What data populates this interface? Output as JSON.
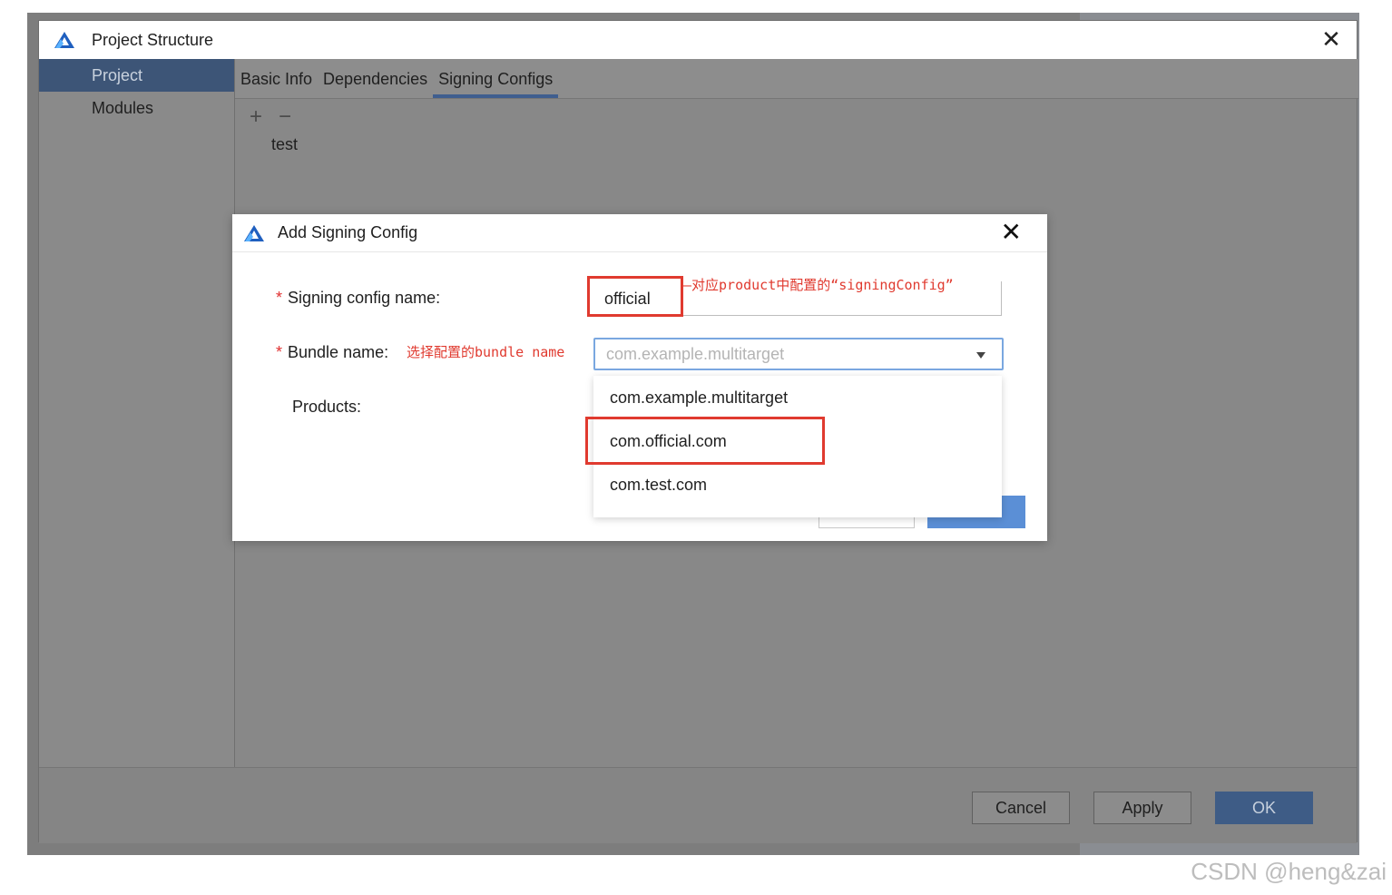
{
  "window": {
    "title": "Project Structure",
    "close_glyph": "✕"
  },
  "sidebar": {
    "items": [
      {
        "label": "Project",
        "active": true
      },
      {
        "label": "Modules",
        "active": false
      }
    ]
  },
  "tabs": [
    {
      "label": "Basic Info",
      "active": false
    },
    {
      "label": "Dependencies",
      "active": false
    },
    {
      "label": "Signing Configs",
      "active": true
    }
  ],
  "toolbar": {
    "add_glyph": "+",
    "remove_glyph": "−"
  },
  "configs": {
    "items": [
      "test"
    ]
  },
  "footer": {
    "cancel_label": "Cancel",
    "apply_label": "Apply",
    "ok_label": "OK"
  },
  "dialog": {
    "title": "Add Signing Config",
    "close_glyph": "✕",
    "signing_config_name": {
      "label": "Signing config name:",
      "required_mark": "*",
      "value": "official"
    },
    "bundle_name": {
      "label": "Bundle name:",
      "required_mark": "*",
      "selected": "com.example.multitarget",
      "options": [
        "com.example.multitarget",
        "com.official.com",
        "com.test.com"
      ]
    },
    "products": {
      "label": "Products:"
    }
  },
  "annotations": {
    "signing_note": "—对应product中配置的“signingConfig”",
    "bundle_note": "选择配置的bundle name"
  },
  "watermark": "CSDN @heng&zai",
  "colors": {
    "accent": "#3e5c86",
    "annotation": "#e03a2f",
    "select_border": "#7aa7e0"
  }
}
